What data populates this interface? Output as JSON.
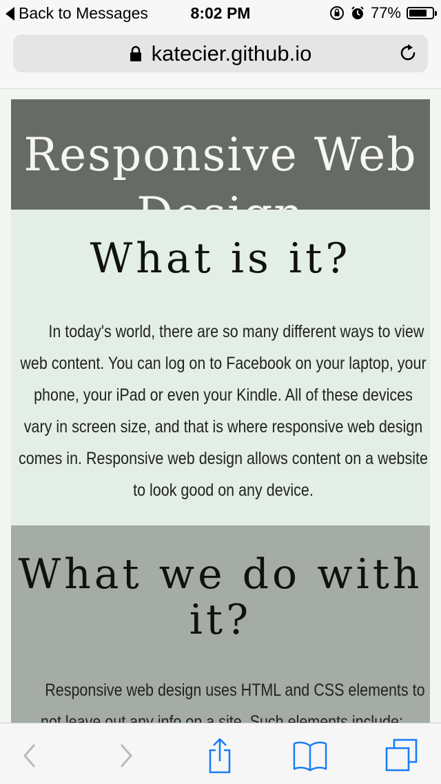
{
  "status_bar": {
    "back_label": "Back to Messages",
    "time": "8:02 PM",
    "battery": "77%",
    "battery_level": 0.77,
    "icons": [
      "orientation-lock-icon",
      "alarm-icon",
      "battery-icon"
    ]
  },
  "browser": {
    "url": "katecier.github.io",
    "lock_icon": "lock-icon",
    "reload_icon": "reload-icon"
  },
  "page": {
    "hero_title": "Responsive Web Design",
    "section1": {
      "title": "What is it?",
      "body": "In today's world, there are so many different ways to view web content. You can log on to Facebook on your laptop, your phone, your iPad or even your Kindle. All of these devices vary in screen size, and that is where responsive web design comes in. Responsive web design allows content on a website to look good on any device."
    },
    "section2": {
      "title": "What we do with it?",
      "body": "Responsive web design uses HTML and CSS elements to not leave out any info on a site. Such elements include:"
    }
  },
  "toolbar": {
    "items": [
      "back-icon",
      "forward-icon",
      "share-icon",
      "bookmarks-icon",
      "tabs-icon"
    ]
  },
  "colors": {
    "ios_blue": "#1a7cf5",
    "hero_bg": "#676b67",
    "section1_bg": "#e3eee6",
    "section2_bg": "#a4aca5"
  }
}
